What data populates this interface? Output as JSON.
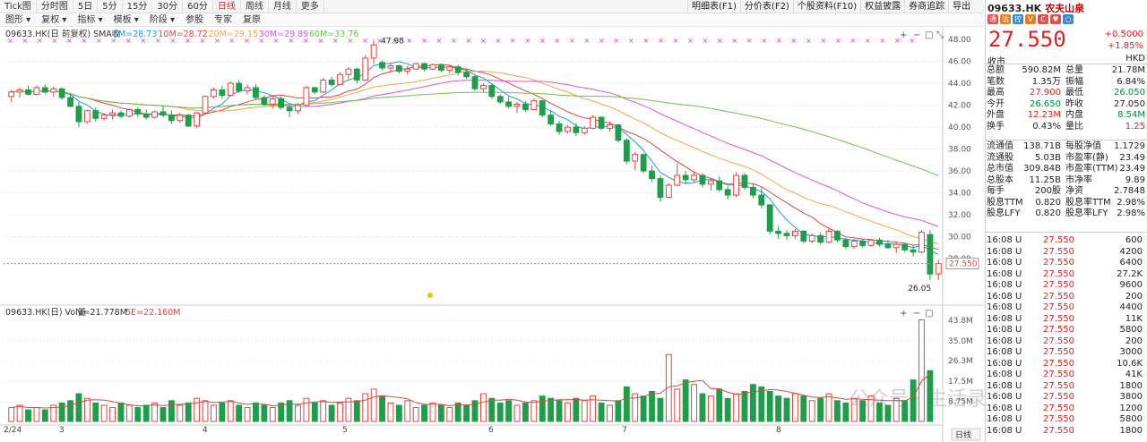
{
  "period_tabs": [
    "Tick图",
    "分时图",
    "5日",
    "5分",
    "15分",
    "30分",
    "60分",
    "日线",
    "周线",
    "月线",
    "更多"
  ],
  "active_tab": "日线",
  "right_buttons": [
    "明细表(F1)",
    "分价表(F2)",
    "个股资料(F10)",
    "权益披露",
    "券商追踪",
    "导出"
  ],
  "toolbar": [
    "图形",
    "复权",
    "指标",
    "模板",
    "阶段",
    "参股",
    "专家",
    "复原"
  ],
  "main_legend": {
    "label": "09633.HK(日 前复权) SMA收",
    "ma": [
      {
        "t": "5M=28.73",
        "c": "#1f9bd8"
      },
      {
        "t": "10M=28.72",
        "c": "#e0463e"
      },
      {
        "t": "20M=29.15",
        "c": "#f2a444"
      },
      {
        "t": "30M=29.89",
        "c": "#d957d9"
      },
      {
        "t": "60M=33.76",
        "c": "#6cc34a"
      }
    ]
  },
  "chart_data": {
    "type": "candlestick",
    "title": "09633.HK(日 前复权)",
    "ylim": [
      25.8,
      48.5
    ],
    "yticks": [
      48.0,
      46.0,
      44.0,
      42.0,
      40.0,
      38.0,
      36.0,
      34.0,
      32.0,
      30.0,
      28.0
    ],
    "x_labels": [
      "2/24",
      "3",
      "4",
      "5",
      "6",
      "7",
      "8"
    ],
    "high_label": "47.98",
    "low_label": "26.05",
    "current_price_label": "27.550",
    "candles": [
      [
        42.8,
        43.4,
        42.3,
        43.2
      ],
      [
        43.2,
        43.6,
        42.7,
        43.4
      ],
      [
        43.4,
        43.8,
        42.9,
        43.0
      ],
      [
        43.0,
        43.8,
        42.9,
        43.6
      ],
      [
        43.6,
        43.9,
        43.0,
        43.2
      ],
      [
        43.2,
        43.7,
        42.8,
        43.5
      ],
      [
        43.5,
        43.6,
        42.5,
        42.7
      ],
      [
        42.7,
        43.0,
        41.8,
        41.9
      ],
      [
        41.9,
        42.3,
        40.0,
        40.5
      ],
      [
        40.5,
        41.6,
        40.3,
        41.5
      ],
      [
        41.5,
        41.8,
        40.5,
        40.8
      ],
      [
        40.8,
        41.3,
        40.6,
        41.1
      ],
      [
        41.1,
        41.6,
        40.7,
        41.3
      ],
      [
        41.3,
        41.5,
        40.8,
        41.0
      ],
      [
        41.0,
        41.7,
        40.9,
        41.6
      ],
      [
        41.6,
        41.8,
        40.9,
        41.2
      ],
      [
        41.2,
        41.6,
        40.7,
        40.9
      ],
      [
        40.9,
        41.5,
        40.8,
        41.4
      ],
      [
        41.4,
        41.9,
        40.9,
        41.1
      ],
      [
        41.1,
        41.5,
        40.3,
        40.6
      ],
      [
        40.6,
        41.3,
        40.4,
        41.1
      ],
      [
        41.1,
        41.2,
        40.0,
        40.1
      ],
      [
        40.1,
        41.4,
        39.9,
        41.3
      ],
      [
        41.3,
        42.9,
        41.2,
        42.8
      ],
      [
        42.8,
        43.6,
        42.6,
        43.4
      ],
      [
        43.4,
        43.8,
        42.6,
        42.9
      ],
      [
        42.9,
        44.2,
        42.8,
        44.0
      ],
      [
        44.0,
        44.3,
        43.1,
        43.3
      ],
      [
        43.3,
        43.9,
        43.0,
        43.6
      ],
      [
        43.6,
        43.9,
        42.5,
        42.7
      ],
      [
        42.7,
        42.9,
        41.9,
        42.1
      ],
      [
        42.1,
        42.9,
        41.7,
        42.6
      ],
      [
        42.6,
        42.8,
        41.6,
        41.8
      ],
      [
        41.8,
        42.0,
        40.9,
        41.5
      ],
      [
        41.5,
        42.2,
        41.2,
        42.0
      ],
      [
        42.0,
        43.8,
        41.9,
        43.6
      ],
      [
        43.6,
        43.7,
        43.0,
        43.2
      ],
      [
        43.2,
        44.5,
        43.1,
        44.3
      ],
      [
        44.3,
        44.6,
        43.7,
        43.9
      ],
      [
        43.9,
        45.0,
        43.8,
        44.8
      ],
      [
        44.8,
        45.5,
        44.4,
        45.3
      ],
      [
        45.3,
        45.4,
        44.0,
        44.3
      ],
      [
        44.3,
        46.6,
        44.2,
        46.3
      ],
      [
        46.3,
        47.98,
        45.8,
        47.5
      ],
      [
        45.9,
        46.1,
        45.2,
        45.4
      ],
      [
        45.4,
        45.9,
        45.0,
        45.6
      ],
      [
        45.6,
        45.7,
        44.9,
        45.1
      ],
      [
        45.1,
        45.6,
        44.8,
        45.3
      ],
      [
        45.3,
        45.9,
        45.2,
        45.8
      ],
      [
        45.8,
        45.9,
        45.1,
        45.3
      ],
      [
        45.3,
        45.8,
        45.2,
        45.7
      ],
      [
        45.7,
        45.8,
        45.0,
        45.2
      ],
      [
        45.2,
        45.7,
        44.9,
        45.5
      ],
      [
        45.5,
        45.7,
        44.7,
        45.0
      ],
      [
        45.0,
        45.3,
        44.4,
        44.6
      ],
      [
        44.6,
        44.8,
        43.3,
        43.5
      ],
      [
        43.5,
        44.0,
        43.2,
        43.8
      ],
      [
        43.8,
        43.9,
        42.6,
        42.8
      ],
      [
        42.8,
        43.0,
        42.1,
        42.3
      ],
      [
        42.3,
        42.8,
        41.7,
        41.9
      ],
      [
        41.9,
        42.3,
        41.3,
        42.1
      ],
      [
        42.1,
        42.4,
        41.4,
        41.6
      ],
      [
        41.6,
        42.6,
        41.5,
        42.4
      ],
      [
        42.4,
        42.5,
        40.9,
        41.1
      ],
      [
        41.1,
        41.5,
        40.1,
        40.3
      ],
      [
        40.3,
        40.6,
        39.3,
        39.6
      ],
      [
        39.6,
        40.2,
        39.4,
        40.0
      ],
      [
        40.0,
        40.4,
        39.2,
        39.5
      ],
      [
        39.5,
        40.1,
        39.3,
        39.9
      ],
      [
        39.9,
        41.1,
        39.8,
        40.9
      ],
      [
        40.9,
        41.0,
        39.7,
        39.9
      ],
      [
        39.9,
        40.5,
        39.6,
        40.2
      ],
      [
        40.2,
        40.3,
        38.6,
        38.8
      ],
      [
        38.8,
        39.0,
        36.6,
        36.9
      ],
      [
        36.9,
        37.7,
        36.1,
        37.5
      ],
      [
        37.5,
        37.6,
        35.8,
        36.0
      ],
      [
        36.0,
        36.5,
        35.0,
        35.3
      ],
      [
        35.3,
        35.6,
        33.2,
        33.6
      ],
      [
        33.6,
        34.9,
        33.5,
        34.7
      ],
      [
        34.7,
        36.7,
        34.6,
        35.6
      ],
      [
        35.6,
        36.0,
        34.8,
        35.2
      ],
      [
        35.2,
        35.9,
        34.9,
        35.6
      ],
      [
        35.6,
        35.8,
        34.5,
        34.8
      ],
      [
        34.8,
        35.3,
        34.2,
        35.1
      ],
      [
        35.1,
        35.5,
        34.1,
        34.3
      ],
      [
        34.3,
        34.6,
        33.4,
        33.8
      ],
      [
        33.8,
        35.9,
        33.6,
        35.6
      ],
      [
        35.6,
        35.8,
        34.3,
        34.5
      ],
      [
        34.5,
        34.9,
        33.5,
        33.8
      ],
      [
        33.8,
        34.5,
        32.6,
        32.9
      ],
      [
        32.9,
        33.0,
        30.2,
        30.5
      ],
      [
        30.5,
        31.0,
        29.8,
        30.3
      ],
      [
        30.3,
        30.6,
        29.7,
        30.1
      ],
      [
        30.1,
        30.7,
        29.8,
        30.5
      ],
      [
        30.5,
        30.6,
        29.4,
        29.6
      ],
      [
        29.6,
        30.3,
        29.4,
        30.1
      ],
      [
        30.1,
        30.4,
        29.3,
        29.5
      ],
      [
        29.5,
        30.7,
        29.4,
        30.5
      ],
      [
        30.5,
        30.6,
        29.5,
        29.7
      ],
      [
        29.7,
        29.9,
        28.9,
        29.1
      ],
      [
        29.1,
        29.8,
        28.9,
        29.6
      ],
      [
        29.6,
        29.8,
        29.0,
        29.2
      ],
      [
        29.2,
        29.8,
        29.1,
        29.7
      ],
      [
        29.7,
        29.9,
        29.1,
        29.3
      ],
      [
        29.3,
        29.7,
        28.9,
        29.0
      ],
      [
        29.0,
        29.5,
        28.5,
        29.3
      ],
      [
        29.3,
        29.4,
        28.6,
        28.8
      ],
      [
        28.8,
        29.2,
        28.2,
        28.6
      ],
      [
        28.6,
        30.6,
        28.5,
        30.4
      ],
      [
        30.2,
        30.6,
        26.05,
        26.6
      ],
      [
        26.6,
        27.9,
        26.05,
        27.55
      ]
    ],
    "volume": {
      "label": "09633.HK(日) Vol量",
      "V": "V=21.778M",
      "MA5": "5E=22.160M",
      "ylim": [
        0,
        45
      ],
      "yticks": [
        "43.8M",
        "35.0M",
        "26.3M",
        "17.5M",
        "8.75M"
      ],
      "values": [
        6,
        7,
        5,
        6,
        5,
        7,
        8,
        9,
        12,
        10,
        8,
        7,
        6,
        8,
        7,
        6,
        7,
        8,
        6,
        9,
        7,
        8,
        10,
        9,
        7,
        8,
        9,
        7,
        6,
        8,
        7,
        6,
        8,
        9,
        7,
        10,
        8,
        9,
        7,
        8,
        10,
        9,
        12,
        14,
        11,
        8,
        7,
        9,
        6,
        7,
        8,
        7,
        6,
        8,
        7,
        9,
        12,
        10,
        8,
        9,
        7,
        8,
        9,
        11,
        10,
        9,
        8,
        10,
        9,
        11,
        8,
        7,
        9,
        15,
        12,
        11,
        13,
        10,
        29,
        14,
        18,
        16,
        12,
        11,
        14,
        10,
        12,
        13,
        16,
        15,
        13,
        11,
        10,
        12,
        11,
        9,
        10,
        12,
        9,
        8,
        10,
        9,
        11,
        8,
        7,
        10,
        9,
        18,
        44,
        22
      ]
    }
  },
  "status_tabs": [
    "日线"
  ],
  "right_panel": {
    "code": "09633.HK",
    "name": "农夫山泉",
    "badges": [
      {
        "t": "通",
        "c": "#d9534f"
      },
      {
        "t": "沽",
        "c": "#e67e22"
      },
      {
        "t": "控",
        "c": "#3a86c8"
      },
      {
        "t": "V",
        "c": "#e67e22"
      },
      {
        "t": "C",
        "c": "#d9534f"
      },
      {
        "t": "♥",
        "c": "#d9534f"
      },
      {
        "t": "○",
        "c": "#3a86c8"
      }
    ],
    "price": "27.550",
    "change": "+0.5000",
    "change_pct": "+1.85%",
    "label_close": "收市",
    "currency": "HKD",
    "stats": [
      [
        "总额",
        "590.82M",
        "总量",
        "21.78M"
      ],
      [
        "笔数",
        "1.35万",
        "振幅",
        "6.84%"
      ],
      [
        "最高",
        "27.900",
        "最低",
        "26.050"
      ],
      [
        "今开",
        "26.650",
        "昨收",
        "27.050"
      ],
      [
        "外盘",
        "12.23M",
        "内盘",
        "8.54M"
      ],
      [
        "换手",
        "0.43%",
        "量比",
        "1.25"
      ]
    ],
    "fund": [
      [
        "流通值",
        "138.71B",
        "每股净值",
        "1.1729"
      ],
      [
        "流通股",
        "5.03B",
        "市盈率(静)",
        "23.49"
      ],
      [
        "总市值",
        "309.84B",
        "市盈率(TTM)",
        "23.49"
      ],
      [
        "总股本",
        "11.25B",
        "市净率",
        "9.89"
      ],
      [
        "每手",
        "200股",
        "净资",
        "2.7848"
      ],
      [
        "股息TTM",
        "0.820",
        "股息率TTM",
        "2.98%"
      ],
      [
        "股息LFY",
        "0.820",
        "股息率LFY",
        "2.98%"
      ]
    ],
    "ticks": [
      [
        "16:08 U",
        "27.550",
        "600"
      ],
      [
        "16:08 U",
        "27.550",
        "4200"
      ],
      [
        "16:08 U",
        "27.550",
        "6400"
      ],
      [
        "16:08 U",
        "27.550",
        "27.2K"
      ],
      [
        "16:08 U",
        "27.550",
        "9600"
      ],
      [
        "16:08 U",
        "27.550",
        "200"
      ],
      [
        "16:08 U",
        "27.550",
        "4400"
      ],
      [
        "16:08 U",
        "27.550",
        "11K"
      ],
      [
        "16:08 U",
        "27.550",
        "5800"
      ],
      [
        "16:08 U",
        "27.550",
        "200"
      ],
      [
        "16:08 U",
        "27.550",
        "3000"
      ],
      [
        "16:08 U",
        "27.550",
        "10.6K"
      ],
      [
        "16:08 U",
        "27.550",
        "41K"
      ],
      [
        "16:08 U",
        "27.550",
        "1800"
      ],
      [
        "16:08 U",
        "27.550",
        "3800"
      ],
      [
        "16:08 U",
        "27.550",
        "1200"
      ],
      [
        "16:08 U",
        "27.550",
        "5800"
      ],
      [
        "16:08 U",
        "27.550",
        "1800"
      ]
    ]
  },
  "watermark": "公众号 · 生活录"
}
